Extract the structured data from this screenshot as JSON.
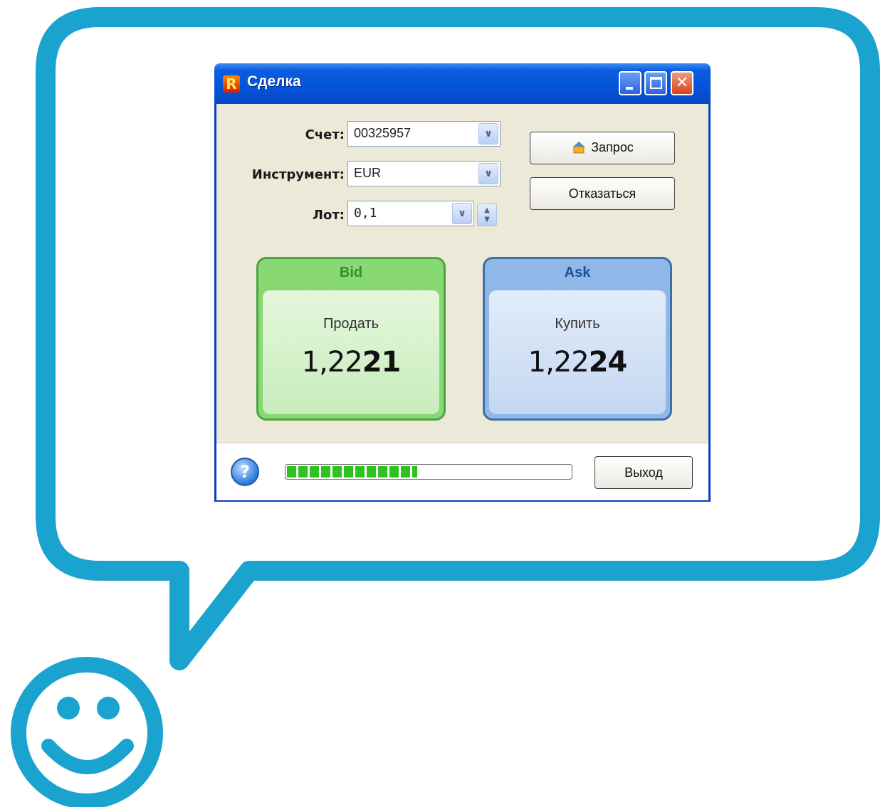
{
  "colors": {
    "bubble": "#1ba3cf",
    "bid": "#88d873",
    "ask": "#8fb8e8",
    "titlebar": "#0553d9"
  },
  "window": {
    "title": "Сделка",
    "app_icon": "R",
    "controls": {
      "minimize_icon": "minimize-icon",
      "maximize_icon": "maximize-icon",
      "close_glyph": "✕"
    }
  },
  "form": {
    "account_label": "Счет:",
    "account_value": "00325957",
    "instrument_label": "Инструмент:",
    "instrument_value": "EUR",
    "lot_label": "Лот:",
    "lot_value": "0,1"
  },
  "buttons": {
    "request": "Запрос",
    "cancel": "Отказаться",
    "exit": "Выход"
  },
  "bid": {
    "head": "Bid",
    "action": "Продать",
    "price_prefix": "1,22",
    "price_bold": "21"
  },
  "ask": {
    "head": "Ask",
    "action": "Купить",
    "price_prefix": "1,22",
    "price_bold": "24"
  },
  "footer": {
    "help_glyph": "?",
    "progress_fraction": 0.46
  }
}
